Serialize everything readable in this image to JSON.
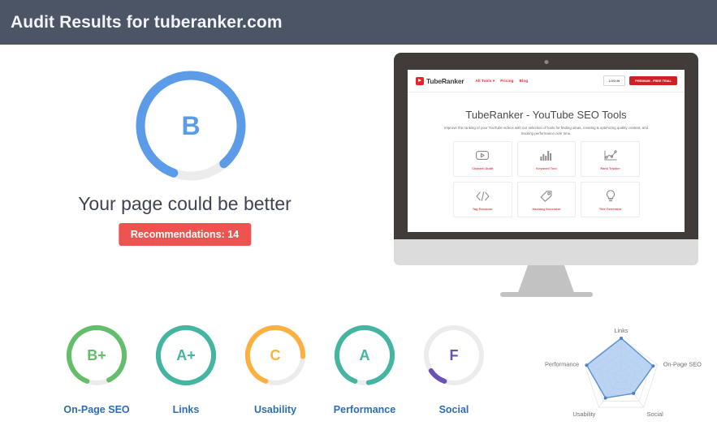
{
  "header": {
    "title": "Audit Results for tuberanker.com"
  },
  "overall": {
    "grade": "B",
    "grade_color": "#5b9be8",
    "percent": 83,
    "message": "Your page could be better",
    "recommendations_label": "Recommendations: 14",
    "recommendations_count": 14,
    "badge_color": "#ef5350"
  },
  "subscores": [
    {
      "label": "On-Page SEO",
      "grade": "B+",
      "percent": 87,
      "color": "#63bd6b"
    },
    {
      "label": "Links",
      "grade": "A+",
      "percent": 100,
      "color": "#43b5a0"
    },
    {
      "label": "Usability",
      "grade": "C",
      "percent": 70,
      "color": "#fbb040"
    },
    {
      "label": "Performance",
      "grade": "A",
      "percent": 92,
      "color": "#43b5a0"
    },
    {
      "label": "Social",
      "grade": "F",
      "percent": 10,
      "color": "#6a51b5"
    }
  ],
  "preview": {
    "brand": "TubeRanker",
    "nav": [
      "All Tools  ▾",
      "Pricing",
      "Blog"
    ],
    "login_label": "LOG IN",
    "trial_label": "PREMIUM - FREE TRIAL",
    "title": "TubeRanker - YouTube SEO Tools",
    "subtitle": "Improve the ranking of your YouTube videos with our selection of tools for finding ideas, creating & optimizing quality content, and tracking performance over time.",
    "tools": [
      {
        "label": "Channel Audit",
        "icon": "video-play-icon"
      },
      {
        "label": "Keyword Tool",
        "icon": "bar-chart-icon"
      },
      {
        "label": "Rank Tracker",
        "icon": "line-graph-icon"
      },
      {
        "label": "Tag Extractor",
        "icon": "code-brackets-icon"
      },
      {
        "label": "Hashtag Generator",
        "icon": "tag-icon"
      },
      {
        "label": "Title Generator",
        "icon": "lightbulb-icon"
      }
    ]
  },
  "chart_data": {
    "type": "radar",
    "title": "",
    "categories": [
      "Links",
      "On-Page SEO",
      "Social",
      "Usability",
      "Performance"
    ],
    "series": [
      {
        "name": "Score",
        "values": [
          100,
          88,
          55,
          70,
          95
        ]
      }
    ],
    "rmax": 100,
    "rings": 5,
    "grid": true,
    "legend": "none",
    "fill_color": "#a8c8f0",
    "line_color": "#5b8fd4",
    "point_color": "#4a7fc8"
  }
}
